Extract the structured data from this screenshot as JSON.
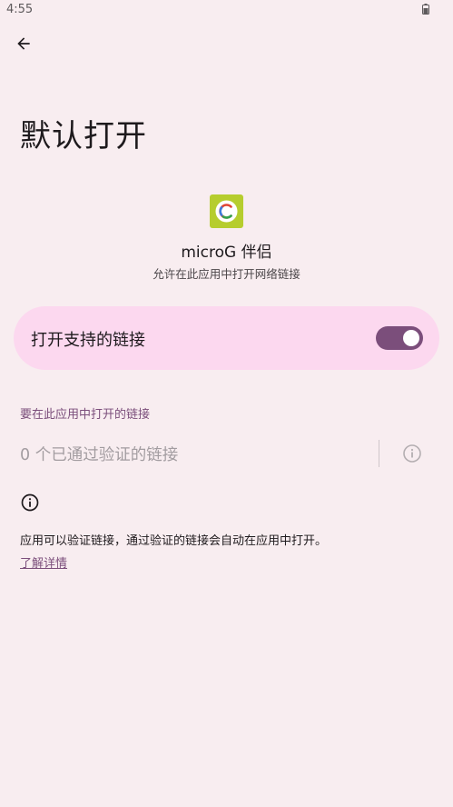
{
  "status_bar": {
    "time": "4:55"
  },
  "header": {
    "back_icon": "arrow-back-icon",
    "title": "默认打开"
  },
  "app": {
    "icon": "microg-companion-icon",
    "name": "microG 伴侣",
    "subtitle": "允许在此应用中打开网络链接"
  },
  "open_supported_links": {
    "label": "打开支持的链接",
    "enabled": true
  },
  "links_section": {
    "header": "要在此应用中打开的链接",
    "verified_count_text": "0 个已通过验证的链接",
    "info_icon": "info-icon"
  },
  "info": {
    "icon": "info-icon",
    "text": "应用可以验证链接，通过验证的链接会自动在应用中打开。",
    "learn_more": "了解详情"
  },
  "colors": {
    "background": "#f8edf0",
    "accent": "#7b4e7b",
    "card": "#fcd8ef"
  }
}
